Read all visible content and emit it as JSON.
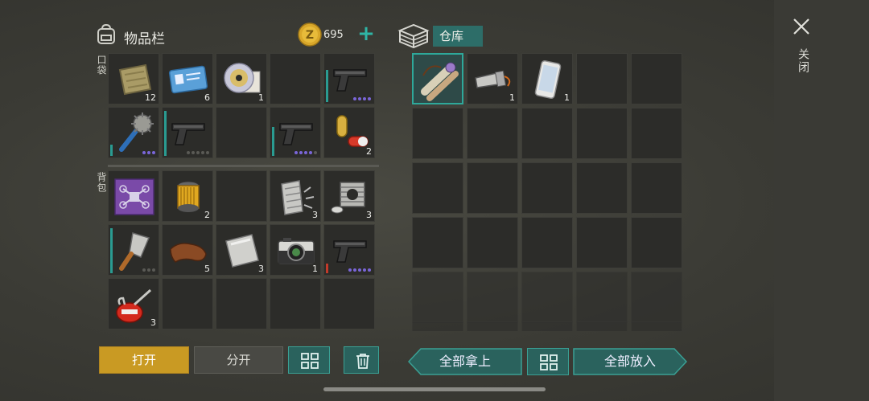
{
  "inventory": {
    "title": "物品栏",
    "coins": "695",
    "pocket_label": "口袋",
    "backpack_label": "背包",
    "pocket_slots": [
      {
        "item": "cloth-bundle",
        "count": "12"
      },
      {
        "item": "id-card",
        "count": "6"
      },
      {
        "item": "cd-disc",
        "count": "1"
      },
      {
        "item": "",
        "count": ""
      },
      {
        "item": "pistol",
        "count": ""
      },
      {
        "item": "spiked-club",
        "count": ""
      },
      {
        "item": "pistol",
        "count": ""
      },
      {
        "item": "",
        "count": ""
      },
      {
        "item": "pistol",
        "count": ""
      },
      {
        "item": "pills",
        "count": "2"
      }
    ],
    "backpack_slots": [
      {
        "item": "drone-blueprint",
        "count": ""
      },
      {
        "item": "oil-filter",
        "count": "2"
      },
      {
        "item": "",
        "count": ""
      },
      {
        "item": "metal-scrap",
        "count": "3"
      },
      {
        "item": "engine-cylinder",
        "count": "3"
      },
      {
        "item": "cleaver",
        "count": ""
      },
      {
        "item": "leather",
        "count": "5"
      },
      {
        "item": "metal-sheet",
        "count": "3"
      },
      {
        "item": "camera",
        "count": "1"
      },
      {
        "item": "pistol",
        "count": ""
      },
      {
        "item": "oil-can",
        "count": "3"
      },
      {
        "item": "",
        "count": ""
      },
      {
        "item": "",
        "count": ""
      },
      {
        "item": "",
        "count": ""
      },
      {
        "item": "",
        "count": ""
      }
    ]
  },
  "storage": {
    "title": "仓库",
    "slots": [
      {
        "item": "scroll-bundle",
        "count": ""
      },
      {
        "item": "flashlight",
        "count": "1"
      },
      {
        "item": "smartphone",
        "count": "1"
      }
    ]
  },
  "buttons": {
    "open": "打开",
    "split": "分开",
    "take_all": "全部拿上",
    "put_all": "全部放入",
    "close": "关闭"
  },
  "colors": {
    "accent_teal": "#2fb5a5",
    "open_gold": "#c99a23",
    "rarity_purple": "#7a66d8"
  }
}
